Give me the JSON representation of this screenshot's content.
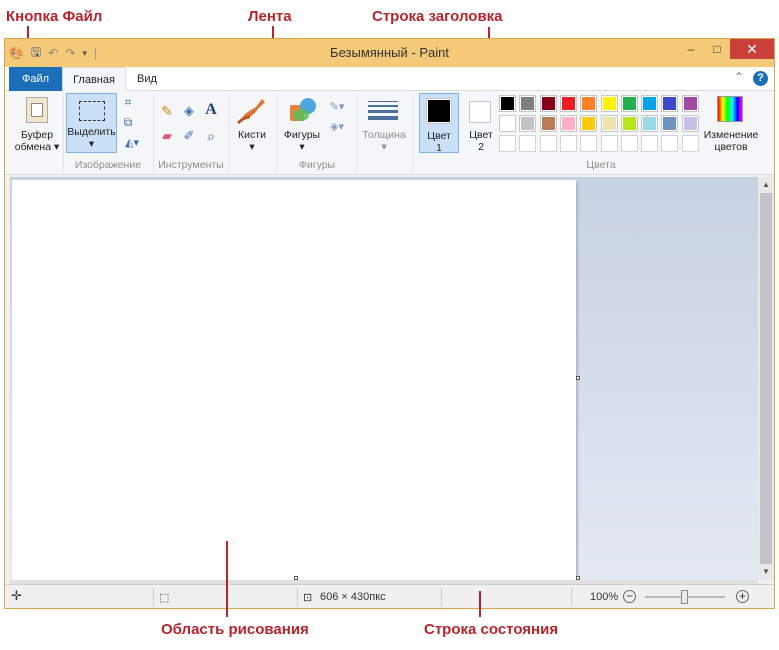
{
  "annotations": {
    "file_button": "Кнопка Файл",
    "ribbon": "Лента",
    "title_bar": "Строка заголовка",
    "drawing_area": "Область рисования",
    "status_bar": "Строка состояния"
  },
  "window": {
    "title": "Безымянный - Paint",
    "controls": {
      "minimize": "‒",
      "maximize": "□",
      "close": "✕"
    }
  },
  "tabs": {
    "file": "Файл",
    "home": "Главная",
    "view": "Вид",
    "help": "?"
  },
  "ribbon": {
    "clipboard": {
      "label_line1": "Буфер",
      "label_line2": "обмена"
    },
    "image": {
      "select_label": "Выделить",
      "group_label": "Изображение"
    },
    "tools": {
      "group_label": "Инструменты",
      "text_tool": "A"
    },
    "brushes": {
      "label": "Кисти"
    },
    "shapes": {
      "label": "Фигуры",
      "group_label": "Фигуры"
    },
    "size": {
      "label": "Толщина"
    },
    "color1": {
      "line1": "Цвет",
      "line2": "1",
      "value": "#000000"
    },
    "color2": {
      "line1": "Цвет",
      "line2": "2",
      "value": "#ffffff"
    },
    "colors": {
      "group_label": "Цвета",
      "row1": [
        "#000000",
        "#7f7f7f",
        "#880015",
        "#ed1c24",
        "#ff7f27",
        "#fff200",
        "#22b14c",
        "#00a2e8",
        "#3f48cc",
        "#a349a4"
      ],
      "row2": [
        "#ffffff",
        "#c3c3c3",
        "#b97a57",
        "#ffaec9",
        "#ffc90e",
        "#efe4b0",
        "#b5e61d",
        "#99d9ea",
        "#7092be",
        "#c8bfe7"
      ],
      "row3": [
        "#ffffff",
        "#ffffff",
        "#ffffff",
        "#ffffff",
        "#ffffff",
        "#ffffff",
        "#ffffff",
        "#ffffff",
        "#ffffff",
        "#ffffff"
      ]
    },
    "edit_colors": {
      "line1": "Изменение",
      "line2": "цветов"
    }
  },
  "statusbar": {
    "size": "606 × 430пкс",
    "zoom": "100%",
    "zoom_level": 0.5
  }
}
